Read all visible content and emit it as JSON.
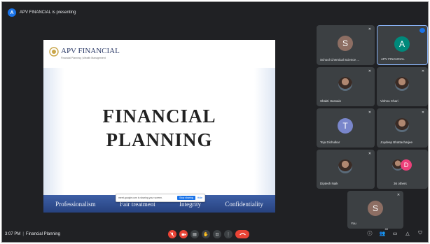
{
  "presenting_banner": {
    "avatar_letter": "A",
    "text": "APV FINANCIAL is presenting"
  },
  "slide": {
    "company_name": "APV FINANCIAL",
    "company_tagline": "Financial Planning | Wealth Management",
    "title_line1": "FINANCIAL",
    "title_line2": "PLANNING",
    "footer_values": [
      "Professionalism",
      "Fair treatment",
      "Integrity",
      "Confidentiality"
    ]
  },
  "share_popup": {
    "message": "meet.google.com is sharing your screen.",
    "stop_label": "Stop sharing",
    "hide_label": "Hide"
  },
  "participants": [
    {
      "name": "School Chemical Science ...",
      "avatar_letter": "S",
      "avatar_color": "#8d6e63"
    },
    {
      "name": "APV FINANCIAL",
      "avatar_letter": "A",
      "avatar_color": "#00897b"
    },
    {
      "name": "Shakti Hussain"
    },
    {
      "name": "Vishnu Chari"
    },
    {
      "name": "Teja Dichulkar",
      "avatar_letter": "T",
      "avatar_color": "#7986cb"
    },
    {
      "name": "Joydeep Bhattacharjee"
    },
    {
      "name": "Diptesh Naik"
    },
    {
      "name": "36 others",
      "avatar_letter": "D",
      "avatar_color": "#ec407a"
    },
    {
      "name": "You",
      "avatar_letter": "S",
      "avatar_color": "#8d6e63"
    }
  ],
  "bottom_bar": {
    "time": "3:07 PM",
    "meeting_name": "Financial Planning",
    "people_count": "40"
  },
  "colors": {
    "background": "#202124",
    "tile": "#3c4043",
    "danger": "#ea4335",
    "accent": "#1a73e8"
  },
  "icons": [
    "mic-off-icon",
    "camera-off-icon",
    "captions-icon",
    "raise-hand-icon",
    "present-icon",
    "more-icon",
    "end-call-icon",
    "info-icon",
    "people-icon",
    "chat-icon",
    "activities-icon",
    "host-controls-icon",
    "pin-icon"
  ]
}
